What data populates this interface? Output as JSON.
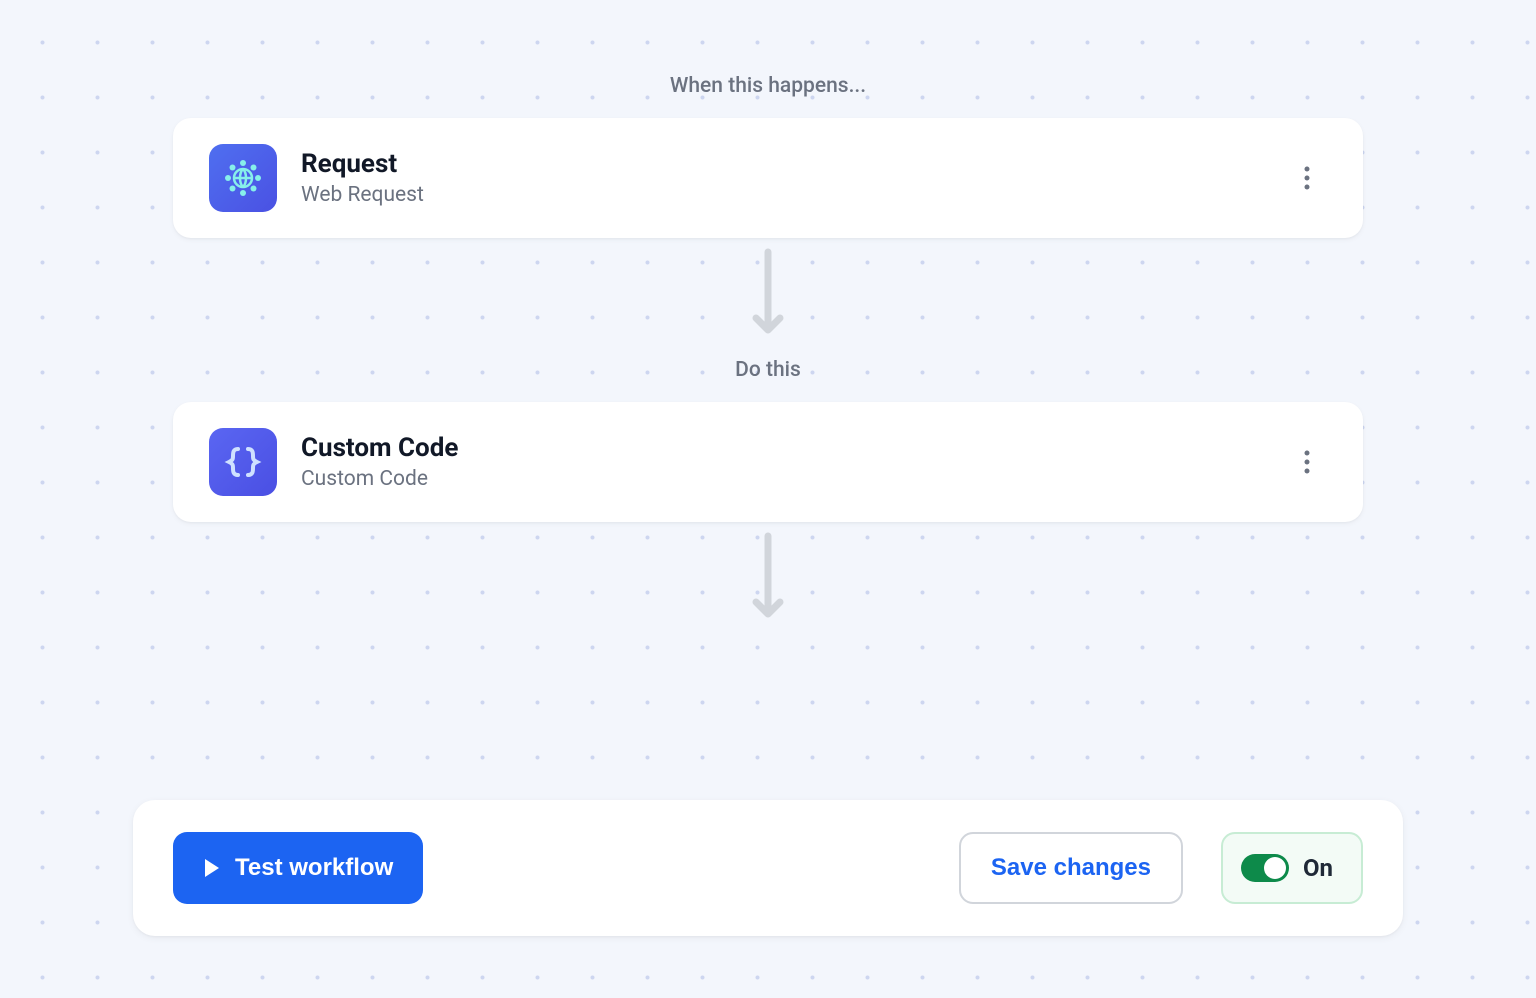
{
  "trigger": {
    "section_label": "When this happens...",
    "title": "Request",
    "subtitle": "Web Request"
  },
  "action": {
    "section_label": "Do this",
    "title": "Custom Code",
    "subtitle": "Custom Code"
  },
  "controls": {
    "test_label": "Test workflow",
    "save_label": "Save changes",
    "toggle_label": "On"
  }
}
